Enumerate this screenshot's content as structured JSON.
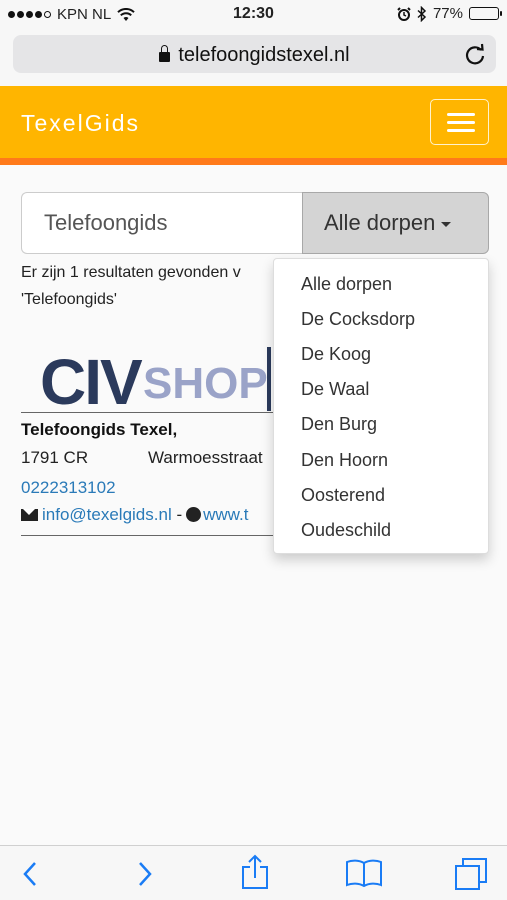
{
  "status": {
    "carrier": "KPN NL",
    "time": "12:30",
    "battery": "77%",
    "battery_level": 0.77
  },
  "browser": {
    "url": "telefoongidstexel.nl"
  },
  "navbar": {
    "brand": "TexelGids",
    "brand_color": "#ffb500",
    "stripe_color": "#ff7a1a"
  },
  "search": {
    "value": "Telefoongids",
    "village_button": "Alle dorpen"
  },
  "result": {
    "line1": "Er zijn 1 resultaten gevonden v",
    "line2": "'Telefoongids'"
  },
  "listing": {
    "logo_left": "CIV",
    "logo_right": "SHOP",
    "name": "Telefoongids Texel,",
    "zip": "1791 CR",
    "street": "Warmoesstraat",
    "phone": "0222313102",
    "email": "info@texelgids.nl",
    "separator": "-",
    "web": "www.t"
  },
  "dropdown": {
    "items": [
      "Alle dorpen",
      "De Cocksdorp",
      "De Koog",
      "De Waal",
      "Den Burg",
      "Den Hoorn",
      "Oosterend",
      "Oudeschild"
    ]
  },
  "toolbar": {
    "icons": [
      "back-icon",
      "forward-icon",
      "share-icon",
      "bookmarks-icon",
      "tabs-icon"
    ],
    "accent": "#1a7cf5"
  }
}
